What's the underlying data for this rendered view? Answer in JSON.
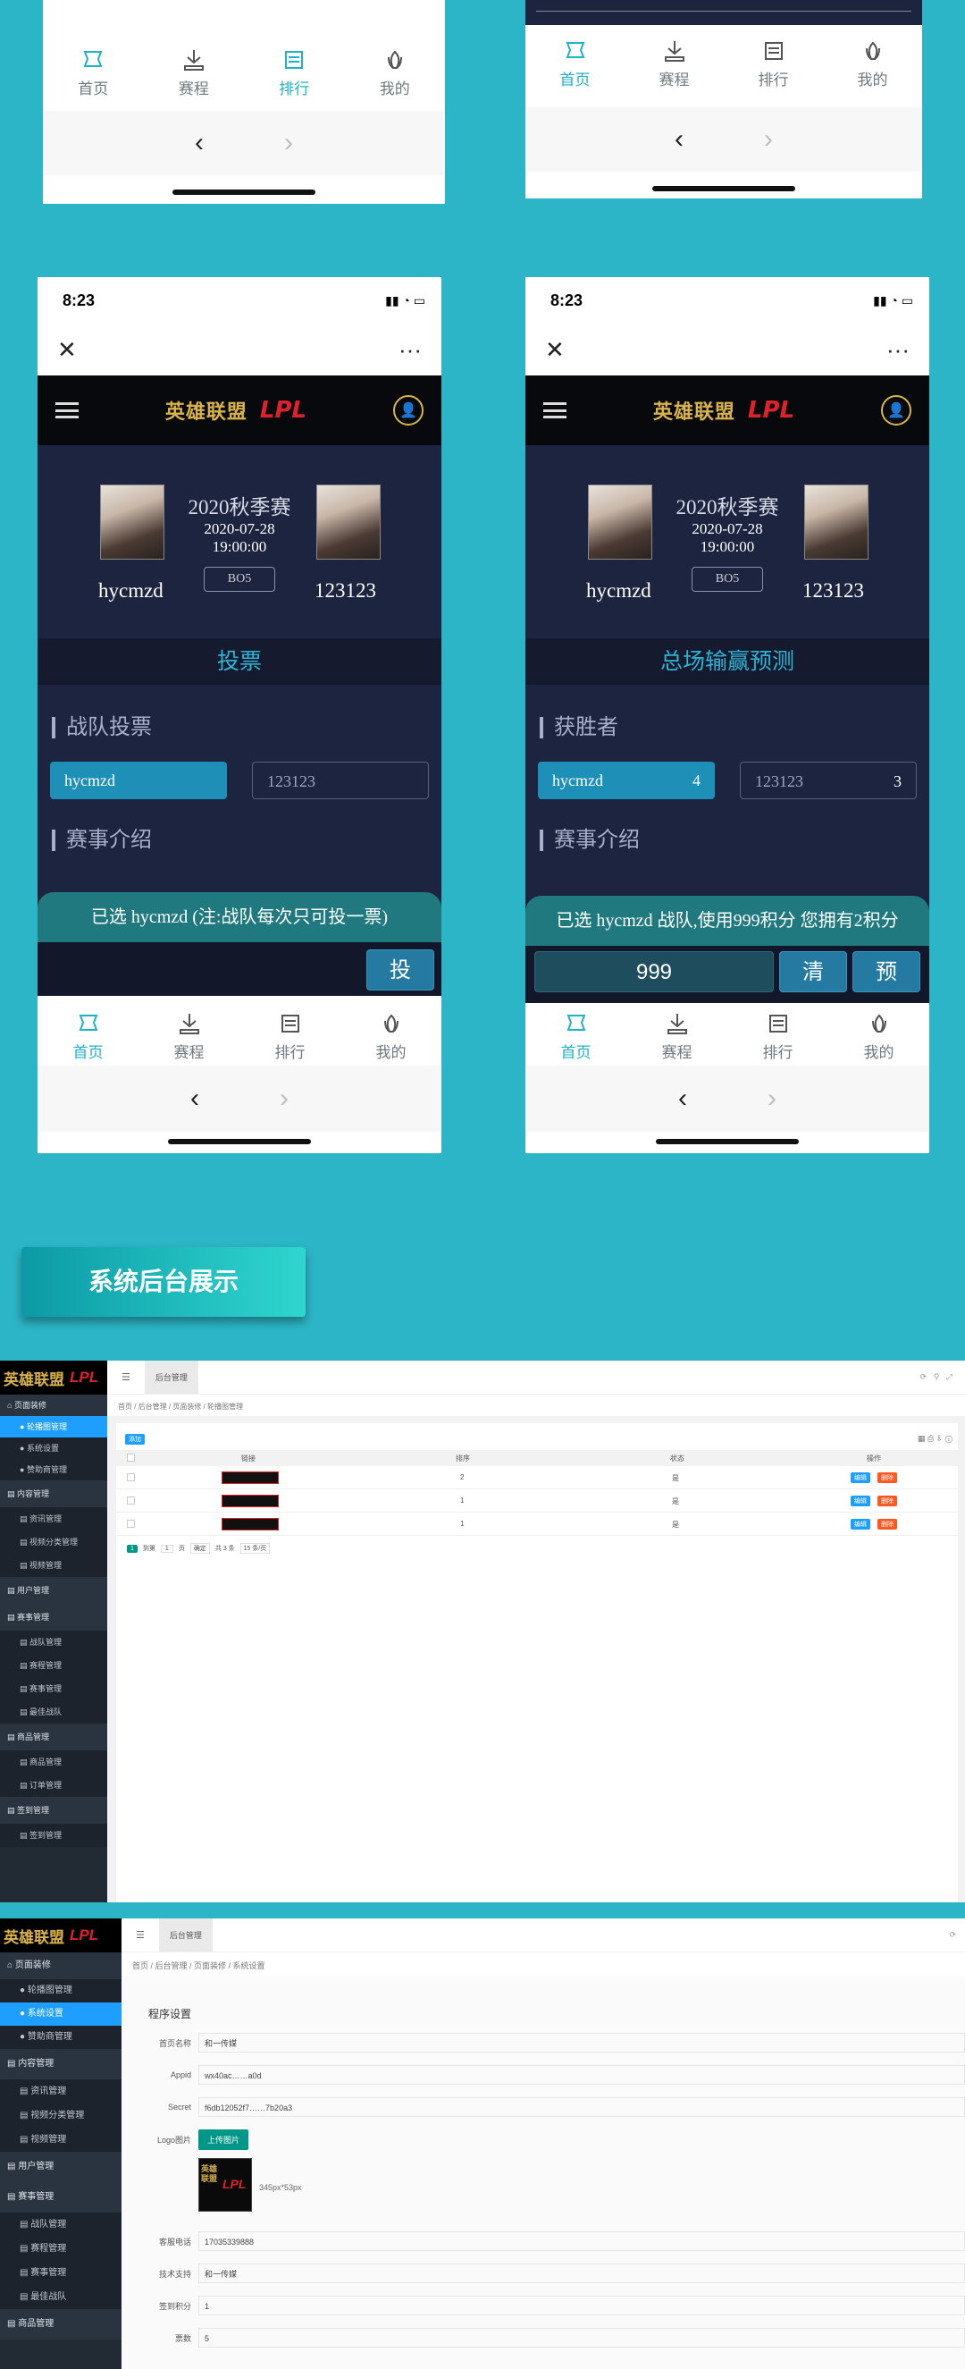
{
  "tabbar": {
    "items": [
      {
        "label": "首页"
      },
      {
        "label": "赛程"
      },
      {
        "label": "排行"
      },
      {
        "label": "我的"
      }
    ]
  },
  "nav": {
    "back": "‹",
    "forward": "›"
  },
  "status": {
    "time": "8:23"
  },
  "header": {
    "lol_logo": "英雄联盟",
    "lpl_logo": "LPL",
    "close": "✕",
    "more": "···"
  },
  "match": {
    "season": "2020秋季赛",
    "date": "2020-07-28",
    "time": "19:00:00",
    "format": "BO5",
    "team_a": "hycmzd",
    "team_b": "123123"
  },
  "vote_page": {
    "section_title": "投票",
    "label_vote": "战队投票",
    "option_a": "hycmzd",
    "option_b": "123123",
    "label_intro": "赛事介绍",
    "notice": "已选 hycmzd (注:战队每次只可投一票)",
    "vote_button": "投"
  },
  "predict_page": {
    "section_title": "总场输赢预测",
    "label_winner": "获胜者",
    "option_a": "hycmzd",
    "option_a_count": "4",
    "option_b": "123123",
    "option_b_count": "3",
    "label_intro": "赛事介绍",
    "notice": "已选 hycmzd 战队,使用999积分 您拥有2积分",
    "points_value": "999",
    "clear_button": "清",
    "predict_button": "预"
  },
  "banner": {
    "text": "系统后台展示"
  },
  "admin1": {
    "tab": "后台管理",
    "crumb": "首页 / 后台管理 / 页面装修 / 轮播图管理",
    "add_button": "添加",
    "headers": [
      "链接",
      "排序",
      "状态",
      "操作"
    ],
    "rows": [
      {
        "sort": "2",
        "status": "是",
        "edit": "编辑",
        "delete": "删除"
      },
      {
        "sort": "1",
        "status": "是",
        "edit": "编辑",
        "delete": "删除"
      },
      {
        "sort": "1",
        "status": "是",
        "edit": "编辑",
        "delete": "删除"
      }
    ],
    "pager": {
      "page": "1",
      "goto": "到第",
      "page_input": "1",
      "page_unit": "页",
      "confirm": "确定",
      "total": "共 3 条",
      "per_page": "15 条/页"
    }
  },
  "sidebar": {
    "groups": [
      {
        "label": "页面装修",
        "items": [
          "轮播图管理",
          "系统设置",
          "赞助商管理"
        ]
      },
      {
        "label": "内容管理",
        "items": [
          "资讯管理",
          "视频分类管理",
          "视频管理"
        ]
      },
      {
        "label": "用户管理",
        "items": []
      },
      {
        "label": "赛事管理",
        "items": [
          "战队管理",
          "赛程管理",
          "赛事管理",
          "最佳战队"
        ]
      },
      {
        "label": "商品管理",
        "items": [
          "商品管理",
          "订单管理"
        ]
      },
      {
        "label": "签到管理",
        "items": [
          "签到管理"
        ]
      }
    ]
  },
  "admin2": {
    "tab": "后台管理",
    "crumb": "首页 / 后台管理 / 页面装修 / 系统设置",
    "section": "程序设置",
    "fields": [
      {
        "label": "首页名称",
        "value": "和一传媒"
      },
      {
        "label": "Appid",
        "value": "wx40ac……a0d"
      },
      {
        "label": "Secret",
        "value": "f6db12052f7……7b20a3"
      }
    ],
    "logo_label": "Logo图片",
    "upload_button": "上传图片",
    "logo_size": "345px*53px",
    "fields2": [
      {
        "label": "客服电话",
        "value": "17035339888"
      },
      {
        "label": "技术支持",
        "value": "和一传媒"
      },
      {
        "label": "签到积分",
        "value": "1"
      },
      {
        "label": "票数",
        "value": "5"
      }
    ]
  }
}
